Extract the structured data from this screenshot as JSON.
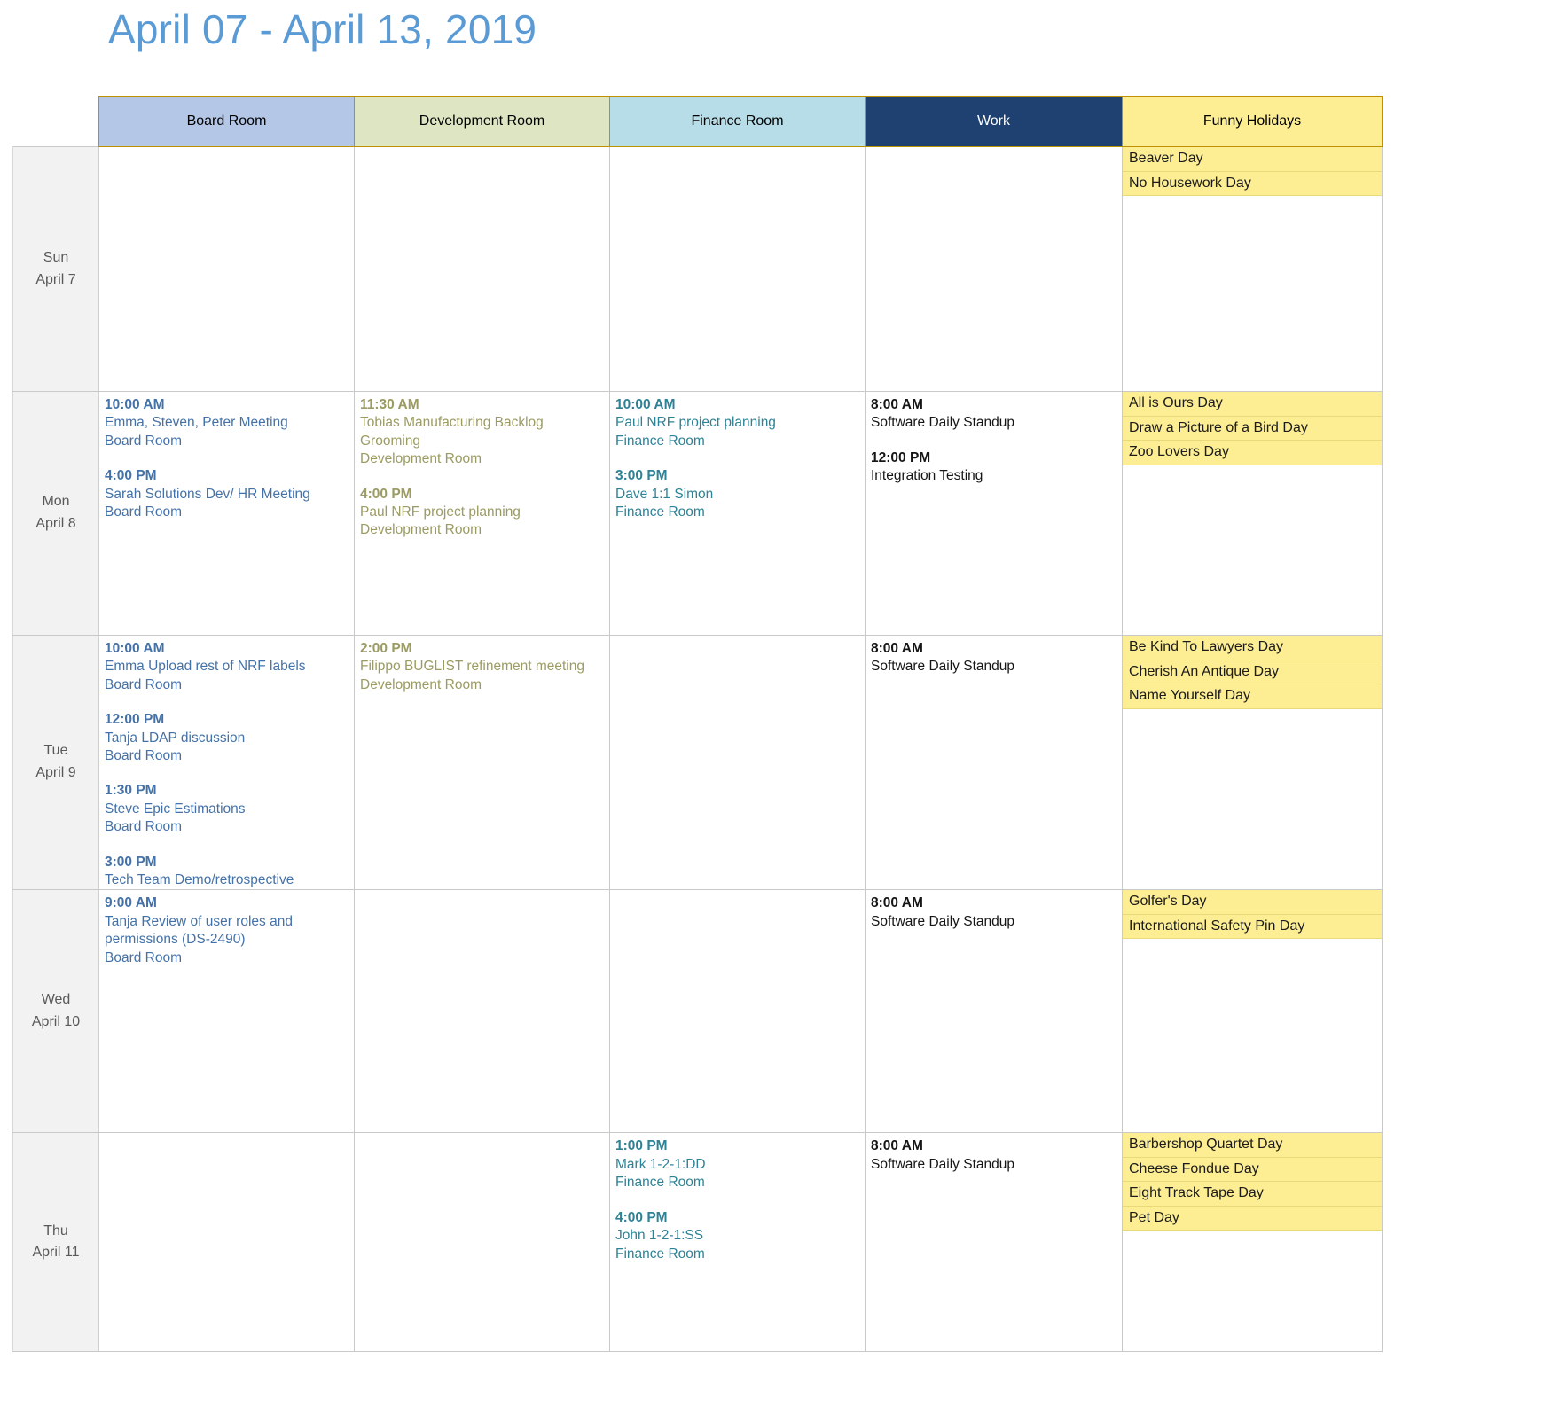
{
  "header": {
    "title": "April 07 - April 13, 2019"
  },
  "columns": [
    {
      "key": "day",
      "label": ""
    },
    {
      "key": "board",
      "label": "Board Room",
      "color": "#b4c7e7"
    },
    {
      "key": "dev",
      "label": "Development Room",
      "color": "#dde5c3"
    },
    {
      "key": "fin",
      "label": "Finance Room",
      "color": "#b6dde8"
    },
    {
      "key": "work",
      "label": "Work",
      "color": "#1f4172"
    },
    {
      "key": "hol",
      "label": "Funny Holidays",
      "color": "#fdee94"
    }
  ],
  "days": [
    {
      "weekday": "Sun",
      "date": "April 7",
      "board": [],
      "dev": [],
      "fin": [],
      "work": [],
      "holidays": [
        "Beaver Day",
        "No Housework Day"
      ]
    },
    {
      "weekday": "Mon",
      "date": "April 8",
      "board": [
        {
          "time": "10:00 AM",
          "lines": [
            "Emma, Steven, Peter Meeting",
            "Board Room"
          ]
        },
        {
          "time": "4:00 PM",
          "lines": [
            "Sarah Solutions Dev/ HR Meeting",
            "Board Room"
          ]
        }
      ],
      "dev": [
        {
          "time": "11:30 AM",
          "lines": [
            "Tobias Manufacturing Backlog",
            "Grooming",
            "Development Room"
          ]
        },
        {
          "time": "4:00 PM",
          "lines": [
            "Paul NRF project planning",
            "Development Room"
          ]
        }
      ],
      "fin": [
        {
          "time": "10:00 AM",
          "lines": [
            "Paul NRF project planning",
            "Finance Room"
          ]
        },
        {
          "time": "3:00 PM",
          "lines": [
            "Dave 1:1 Simon",
            "Finance Room"
          ]
        }
      ],
      "work": [
        {
          "time": "8:00 AM",
          "lines": [
            "Software Daily Standup"
          ]
        },
        {
          "time": "12:00 PM",
          "lines": [
            "Integration Testing"
          ]
        }
      ],
      "holidays": [
        "All is Ours Day",
        "Draw a Picture of a Bird Day",
        "Zoo Lovers Day"
      ]
    },
    {
      "weekday": "Tue",
      "date": "April 9",
      "board": [
        {
          "time": "10:00 AM",
          "lines": [
            "Emma Upload rest of NRF labels",
            "Board Room"
          ]
        },
        {
          "time": "12:00 PM",
          "lines": [
            "Tanja LDAP discussion",
            "Board Room"
          ]
        },
        {
          "time": "1:30 PM",
          "lines": [
            "Steve Epic Estimations",
            "Board Room"
          ]
        },
        {
          "time": "3:00 PM",
          "lines": [
            "Tech Team Demo/retrospective"
          ]
        }
      ],
      "dev": [
        {
          "time": "2:00 PM",
          "lines": [
            "Filippo BUGLIST refinement meeting",
            "Development Room"
          ]
        }
      ],
      "fin": [],
      "work": [
        {
          "time": "8:00 AM",
          "lines": [
            "Software Daily Standup"
          ]
        }
      ],
      "holidays": [
        "Be Kind To Lawyers Day",
        "Cherish An Antique Day",
        "Name Yourself Day"
      ]
    },
    {
      "weekday": "Wed",
      "date": "April 10",
      "board": [
        {
          "time": "9:00 AM",
          "lines": [
            "Tanja Review of user roles and",
            "permissions (DS-2490)",
            "Board Room"
          ]
        }
      ],
      "dev": [],
      "fin": [],
      "work": [
        {
          "time": "8:00 AM",
          "lines": [
            "Software Daily Standup"
          ]
        }
      ],
      "holidays": [
        "Golfer's Day",
        "International Safety Pin Day"
      ]
    },
    {
      "weekday": "Thu",
      "date": "April 11",
      "board": [],
      "dev": [],
      "fin": [
        {
          "time": "1:00 PM",
          "lines": [
            "Mark 1-2-1:DD",
            "Finance Room"
          ]
        },
        {
          "time": "4:00 PM",
          "lines": [
            "John 1-2-1:SS",
            "Finance Room"
          ]
        }
      ],
      "work": [
        {
          "time": "8:00 AM",
          "lines": [
            "Software Daily Standup"
          ]
        }
      ],
      "holidays": [
        "Barbershop Quartet Day",
        "Cheese Fondue Day",
        "Eight Track Tape Day",
        "Pet Day"
      ]
    }
  ]
}
